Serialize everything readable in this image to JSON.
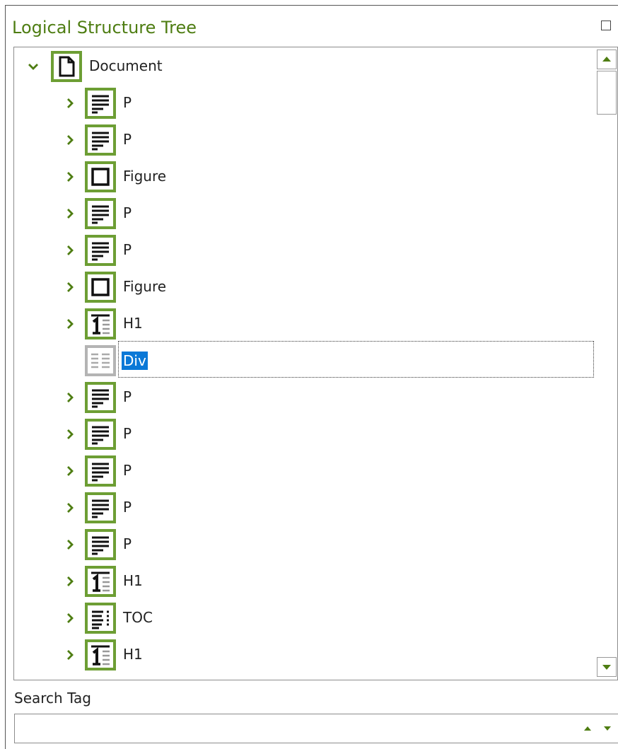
{
  "panel": {
    "title": "Logical Structure Tree",
    "maximize_icon": "maximize-icon"
  },
  "colors": {
    "accent_green": "#6d9e34",
    "title_green": "#4e7d12",
    "selection_blue": "#0a78d7"
  },
  "tree": {
    "root": {
      "label": "Document",
      "icon": "document-icon",
      "expanded": true
    },
    "children": [
      {
        "label": "P",
        "icon": "paragraph-icon",
        "expandable": true
      },
      {
        "label": "P",
        "icon": "paragraph-icon",
        "expandable": true
      },
      {
        "label": "Figure",
        "icon": "figure-icon",
        "expandable": true
      },
      {
        "label": "P",
        "icon": "paragraph-icon",
        "expandable": true
      },
      {
        "label": "P",
        "icon": "paragraph-icon",
        "expandable": true
      },
      {
        "label": "Figure",
        "icon": "figure-icon",
        "expandable": true
      },
      {
        "label": "H1",
        "icon": "heading-icon",
        "expandable": true
      },
      {
        "label": "Div",
        "icon": "div-icon",
        "expandable": false,
        "selected": true
      },
      {
        "label": "P",
        "icon": "paragraph-icon",
        "expandable": true
      },
      {
        "label": "P",
        "icon": "paragraph-icon",
        "expandable": true
      },
      {
        "label": "P",
        "icon": "paragraph-icon",
        "expandable": true
      },
      {
        "label": "P",
        "icon": "paragraph-icon",
        "expandable": true
      },
      {
        "label": "P",
        "icon": "paragraph-icon",
        "expandable": true
      },
      {
        "label": "H1",
        "icon": "heading-icon",
        "expandable": true
      },
      {
        "label": "TOC",
        "icon": "toc-icon",
        "expandable": true
      },
      {
        "label": "H1",
        "icon": "heading-icon",
        "expandable": true
      }
    ]
  },
  "search": {
    "label": "Search Tag",
    "value": "",
    "placeholder": ""
  }
}
